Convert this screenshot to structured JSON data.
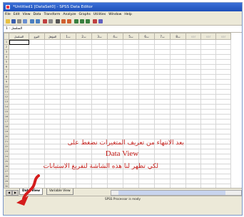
{
  "window": {
    "title": "*Untitled1 [DataSet0] - SPSS Data Editor"
  },
  "menu": [
    "File",
    "Edit",
    "View",
    "Data",
    "Transform",
    "Analyze",
    "Graphs",
    "Utilities",
    "Window",
    "Help"
  ],
  "cell_ref": "1 : السلسل",
  "grid": {
    "columns": [
      "السلسل",
      "النوع",
      "المؤهل",
      "ت1",
      "ت2",
      "ت3",
      "ت4",
      "ت5",
      "ت6",
      "ت7",
      "ت8",
      "var",
      "var",
      "var"
    ],
    "rows": [
      "1",
      "2",
      "3",
      "4",
      "5",
      "6",
      "7",
      "8",
      "9",
      "10",
      "11",
      "12",
      "13",
      "14",
      "15",
      "16",
      "17",
      "18",
      "19",
      "20",
      "21",
      "22",
      "23",
      "24",
      "25",
      "26",
      "27",
      "28",
      "29",
      "30"
    ]
  },
  "tabs": {
    "data_view": "Data View",
    "variable_view": "Variable View"
  },
  "status": "SPSS Processor is ready",
  "annotation": {
    "line1": "بعد الانتهاء من تعريف المتغيرات نضغط على",
    "line2": "Data View",
    "line3": "لكي تظهر لنا هذه الشاشة لتفريغ الاستبانات"
  },
  "colors": {
    "titlebar": "#1d4fb8",
    "annotation": "#c4201c"
  }
}
